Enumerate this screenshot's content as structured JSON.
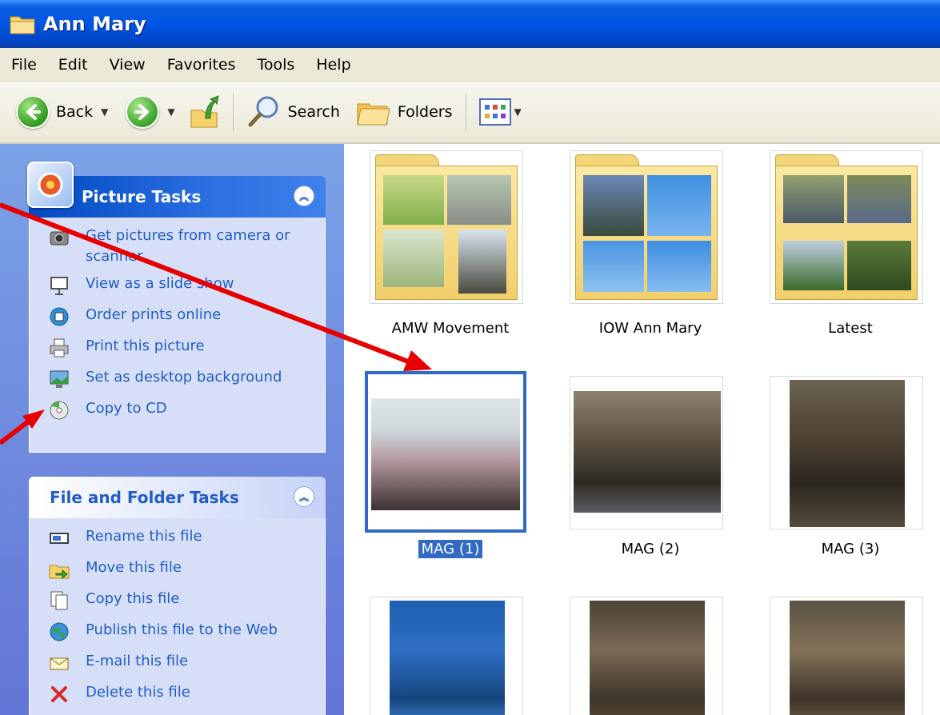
{
  "window": {
    "title": "Ann Mary"
  },
  "menu": [
    "File",
    "Edit",
    "View",
    "Favorites",
    "Tools",
    "Help"
  ],
  "toolbar": {
    "back": "Back",
    "search": "Search",
    "folders": "Folders"
  },
  "picture_tasks": {
    "title": "Picture Tasks",
    "items": [
      {
        "label": "Get pictures from camera or scanner",
        "icon": "camera-icon"
      },
      {
        "label": "View as a slide show",
        "icon": "slideshow-icon"
      },
      {
        "label": "Order prints online",
        "icon": "order-prints-icon"
      },
      {
        "label": "Print this picture",
        "icon": "printer-icon"
      },
      {
        "label": "Set as desktop background",
        "icon": "desktop-background-icon"
      },
      {
        "label": "Copy to CD",
        "icon": "cd-icon"
      }
    ]
  },
  "file_tasks": {
    "title": "File and Folder Tasks",
    "items": [
      {
        "label": "Rename this file",
        "icon": "rename-icon"
      },
      {
        "label": "Move this file",
        "icon": "move-icon"
      },
      {
        "label": "Copy this file",
        "icon": "copy-icon"
      },
      {
        "label": "Publish this file to the Web",
        "icon": "globe-icon"
      },
      {
        "label": "E-mail this file",
        "icon": "email-icon"
      },
      {
        "label": "Delete this file",
        "icon": "delete-icon"
      }
    ]
  },
  "items": [
    {
      "name": "AMW Movement",
      "kind": "folder"
    },
    {
      "name": "IOW Ann Mary",
      "kind": "folder"
    },
    {
      "name": "Latest",
      "kind": "folder"
    },
    {
      "name": "MAG (1)",
      "kind": "photo",
      "selected": true
    },
    {
      "name": "MAG (2)",
      "kind": "photo"
    },
    {
      "name": "MAG (3)",
      "kind": "photo"
    },
    {
      "name": "",
      "kind": "photo"
    },
    {
      "name": "",
      "kind": "photo"
    },
    {
      "name": "",
      "kind": "photo"
    }
  ],
  "colors": {
    "title_bar": "#0054e3",
    "task_link": "#215dc6",
    "selection": "#316ac5",
    "annotation_arrow": "#e60000"
  }
}
